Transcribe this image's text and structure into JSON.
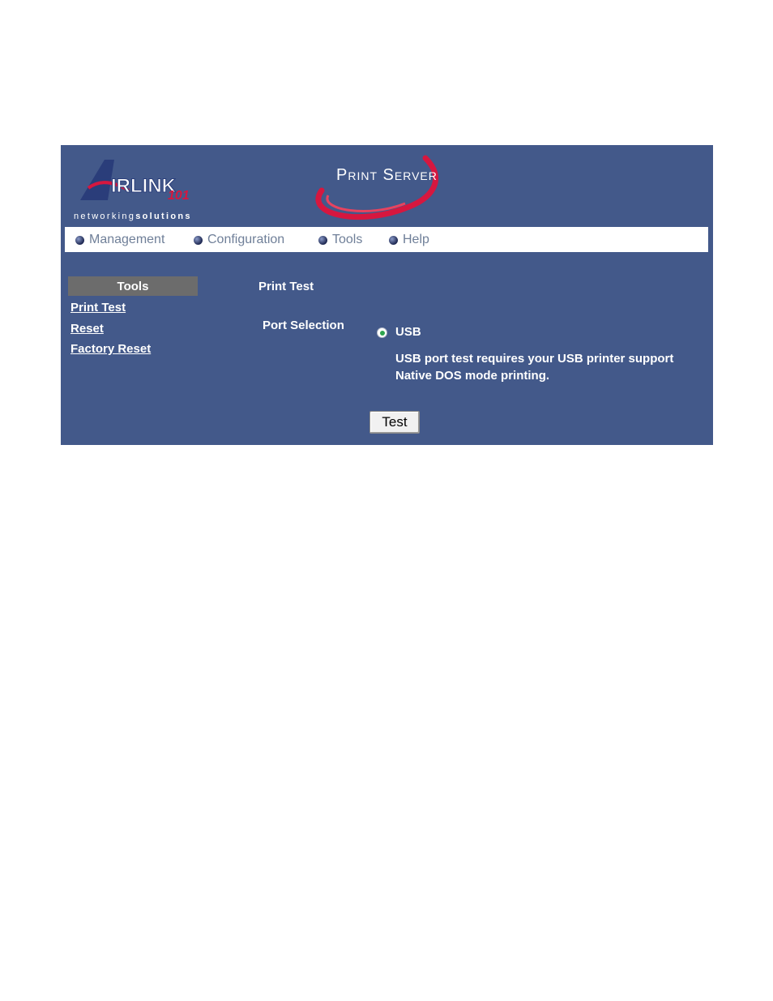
{
  "brand": {
    "logo_text": "AIRLINK",
    "logo_number": "101",
    "tagline_light": "networking",
    "tagline_bold": "solutions"
  },
  "header": {
    "product_title": "Print Server"
  },
  "nav": {
    "items": [
      {
        "label": "Management"
      },
      {
        "label": "Configuration"
      },
      {
        "label": "Tools"
      },
      {
        "label": "Help"
      }
    ]
  },
  "sidebar": {
    "heading": "Tools",
    "links": [
      {
        "label": "Print Test"
      },
      {
        "label": "Reset"
      },
      {
        "label": "Factory Reset"
      }
    ]
  },
  "main": {
    "section_title": "Print Test",
    "port_label": "Port Selection",
    "port_option": "USB",
    "port_selected": true,
    "note": "USB port test requires your USB printer support Native DOS mode printing.",
    "test_button": "Test"
  },
  "colors": {
    "panel": "#43598a",
    "nav_text": "#6f7f98",
    "accent_red": "#d6173f",
    "radio_selected": "#2ea44f"
  }
}
